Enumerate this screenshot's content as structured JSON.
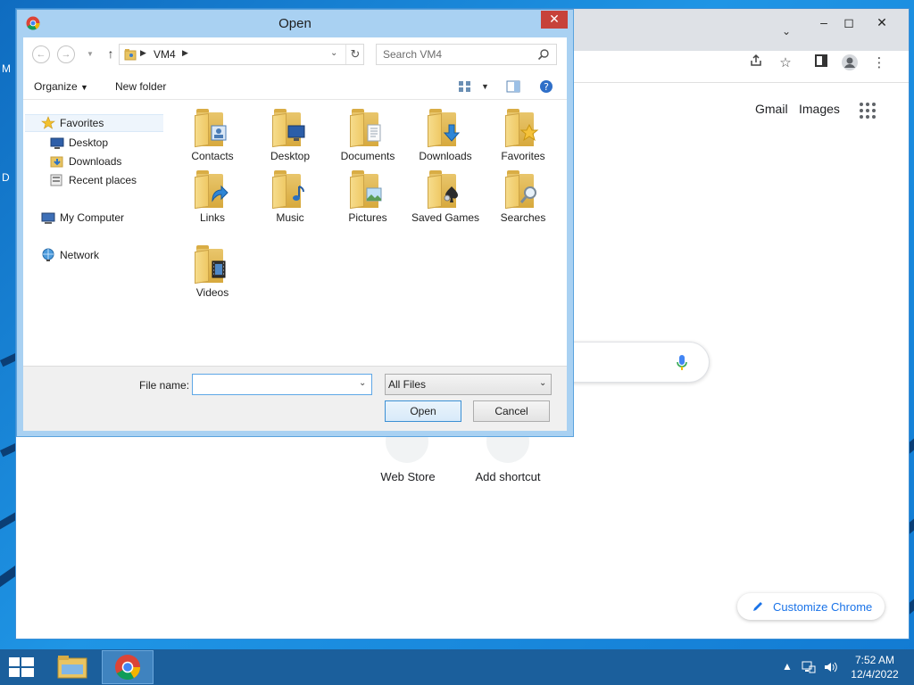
{
  "desktop": {
    "label_1": "M",
    "label_2": "D"
  },
  "chrome": {
    "links": {
      "gmail": "Gmail",
      "images": "Images"
    },
    "shortcuts": [
      {
        "label": "Web Store"
      },
      {
        "label": "Add shortcut"
      }
    ],
    "customize_label": "Customize Chrome",
    "accent": "#1a73e8"
  },
  "dialog": {
    "title": "Open",
    "address": {
      "location": "VM4"
    },
    "search": {
      "placeholder": "Search VM4"
    },
    "commands": {
      "organize": "Organize",
      "new_folder": "New folder"
    },
    "nav": {
      "favorites": "Favorites",
      "desktop": "Desktop",
      "downloads": "Downloads",
      "recent_places": "Recent places",
      "my_computer": "My Computer",
      "network": "Network"
    },
    "folders": [
      {
        "label": "Contacts",
        "icon": "contacts-icon"
      },
      {
        "label": "Desktop",
        "icon": "desktop-icon"
      },
      {
        "label": "Documents",
        "icon": "documents-icon"
      },
      {
        "label": "Downloads",
        "icon": "downloads-icon"
      },
      {
        "label": "Favorites",
        "icon": "favorites-icon"
      },
      {
        "label": "Links",
        "icon": "links-icon"
      },
      {
        "label": "Music",
        "icon": "music-icon"
      },
      {
        "label": "Pictures",
        "icon": "pictures-icon"
      },
      {
        "label": "Saved Games",
        "icon": "saved-games-icon"
      },
      {
        "label": "Searches",
        "icon": "searches-icon"
      },
      {
        "label": "Videos",
        "icon": "videos-icon"
      }
    ],
    "file_name": {
      "label": "File name:",
      "value": ""
    },
    "file_type": {
      "selected": "All Files"
    },
    "buttons": {
      "open": "Open",
      "cancel": "Cancel"
    }
  },
  "taskbar": {
    "clock": {
      "time": "7:52 AM",
      "date": "12/4/2022"
    }
  }
}
